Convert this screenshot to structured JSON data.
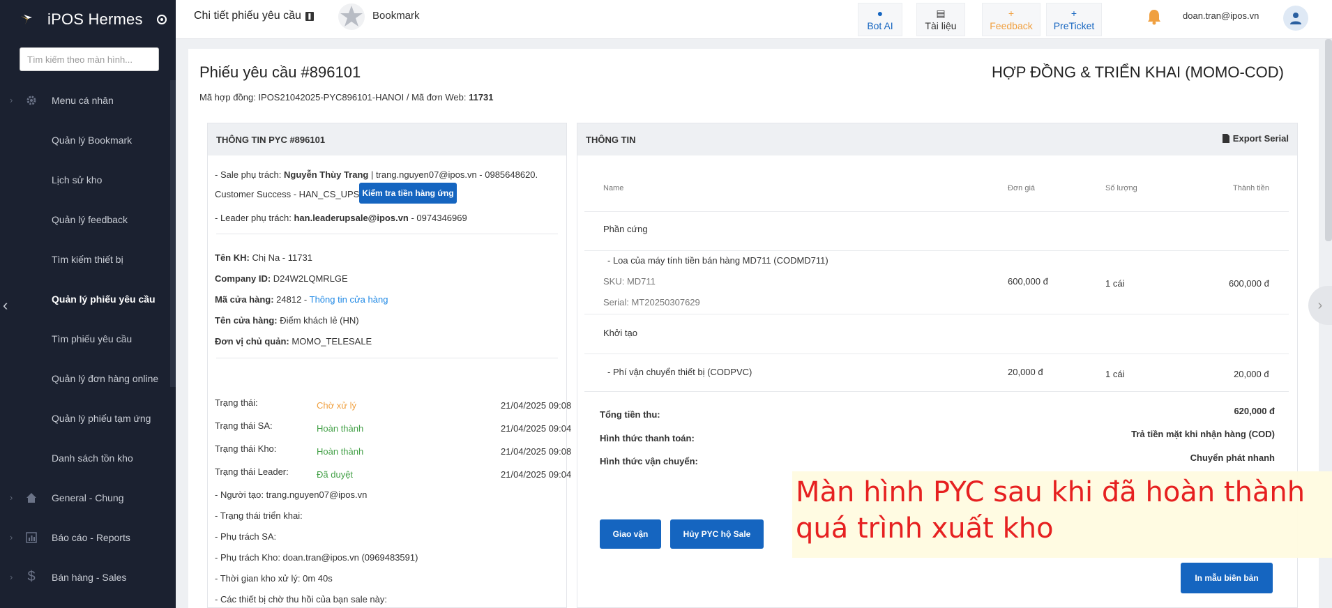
{
  "sidebar": {
    "brand": "iPOS Hermes",
    "search_placeholder": "Tìm kiếm theo màn hình...",
    "items": [
      {
        "label": "Menu cá nhân",
        "icon": "gear-icon",
        "group": true
      },
      {
        "label": "Quản lý Bookmark"
      },
      {
        "label": "Lịch sử kho"
      },
      {
        "label": "Quản lý feedback"
      },
      {
        "label": "Tìm kiếm thiết bị"
      },
      {
        "label": "Quản lý phiếu yêu cầu",
        "active": true
      },
      {
        "label": "Tìm phiếu yêu cầu"
      },
      {
        "label": "Quản lý đơn hàng online"
      },
      {
        "label": "Quản lý phiếu tạm ứng"
      },
      {
        "label": "Danh sách tồn kho"
      },
      {
        "label": "General - Chung",
        "icon": "home-icon",
        "group": true
      },
      {
        "label": "Báo cáo - Reports",
        "icon": "chart-icon",
        "group": true
      },
      {
        "label": "Bán hàng - Sales",
        "icon": "dollar-icon",
        "group": true
      }
    ]
  },
  "topbar": {
    "title": "Chi tiết phiếu yêu cầu",
    "bookmark_label": "Bookmark",
    "buttons": [
      {
        "label": "Bot AI",
        "icon": "chat-icon",
        "color": "#1565c0"
      },
      {
        "label": "Tài liệu",
        "icon": "document-icon",
        "color": "#333333"
      },
      {
        "label": "Feedback",
        "icon": "plus-icon",
        "color": "#f0a040"
      },
      {
        "label": "PreTicket",
        "icon": "plus-icon",
        "color": "#1565c0"
      }
    ],
    "user_email": "doan.tran@ipos.vn"
  },
  "header": {
    "pyc_title": "Phiếu yêu cầu #896101",
    "contract_title": "HỢP ĐỒNG & TRIỂN KHAI (MOMO-COD)",
    "contract_prefix": "Mã hợp đồng: IPOS21042025-PYC896101-HANOI / Mã đơn Web: ",
    "web_order": "11731"
  },
  "left": {
    "heading": "THÔNG TIN PYC #896101",
    "sale_prefix": "- Sale phụ trách: ",
    "sale_name": "Nguyễn Thùy Trang",
    "sale_suffix": " | trang.nguyen07@ipos.vn - 0985648620.",
    "cs_line": "Customer Success - HAN_CS_UPSALES",
    "check_button": "Kiểm tra tiền hàng ứng",
    "leader_prefix": "- Leader phụ trách: ",
    "leader_email": "han.leaderupsale@ipos.vn",
    "leader_suffix": " - 0974346969",
    "customer_label": "Tên KH:",
    "customer_value": " Chị Na - 11731",
    "company_label": "Company ID:",
    "company_value": " D24W2LQMRLGE",
    "store_code_label": "Mã cửa hàng:",
    "store_code_value": " 24812 - ",
    "store_link": "Thông tin cửa hàng",
    "store_name_label": "Tên cửa hàng:",
    "store_name_value": " Điểm khách lẻ (HN)",
    "owner_label": "Đơn vị chủ quản:",
    "owner_value": " MOMO_TELESALE",
    "statuses": [
      {
        "label": "Trạng thái:",
        "value": "Chờ xử lý",
        "time": "21/04/2025 09:08",
        "color": "#f0a040"
      },
      {
        "label": "Trạng thái SA:",
        "value": "Hoàn thành",
        "time": "21/04/2025 09:04",
        "color": "#43a047"
      },
      {
        "label": "Trạng thái Kho:",
        "value": "Hoàn thành",
        "time": "21/04/2025 09:08",
        "color": "#43a047"
      },
      {
        "label": "Trạng thái Leader:",
        "value": "Đã duyệt",
        "time": "21/04/2025 09:04",
        "color": "#43a047"
      }
    ],
    "creator": "- Người tạo: trang.nguyen07@ipos.vn",
    "deploy_status": "- Trạng thái triển khai:",
    "sa_owner": "- Phụ trách SA:",
    "warehouse_owner": "- Phụ trách Kho: doan.tran@ipos.vn (0969483591)",
    "warehouse_time": "- Thời gian kho xử lý: 0m 40s",
    "pending_devices": "- Các thiết bị chờ thu hồi của bạn sale này:"
  },
  "right": {
    "heading": "THÔNG TIN",
    "export_label": "Export Serial",
    "columns": {
      "name": "Name",
      "price": "Đơn giá",
      "qty": "Số lượng",
      "total": "Thành tiền"
    },
    "groups": [
      {
        "title": "Phần cứng",
        "items": [
          {
            "name": "- Loa của máy tính tiền bán hàng MD711 (CODMD711)",
            "sku": "SKU: MD711",
            "serial": "Serial: MT20250307629",
            "price": "600,000 đ",
            "qty": "1 cái",
            "total": "600,000 đ"
          }
        ]
      },
      {
        "title": "Khởi tạo",
        "items": [
          {
            "name": "- Phí vận chuyển thiết bị (CODPVC)",
            "price": "20,000 đ",
            "qty": "1 cái",
            "total": "20,000 đ"
          }
        ]
      }
    ],
    "summary": {
      "total_label": "Tổng tiền thu:",
      "total_value": "620,000 đ",
      "payment_label": "Hình thức thanh toán:",
      "payment_value": "Trả tiền mặt khi nhận hàng (COD)",
      "shipping_label": "Hình thức vận chuyển:",
      "shipping_value": "Chuyển phát nhanh"
    },
    "btn_ship": "Giao vận",
    "btn_cancel": "Hủy PYC hộ Sale",
    "btn_print": "In mẫu biên bản"
  },
  "annotation": {
    "line1": "Màn hình PYC sau khi đã hoàn thành",
    "line2": "quá trình xuất kho",
    "color": "#e62020"
  }
}
